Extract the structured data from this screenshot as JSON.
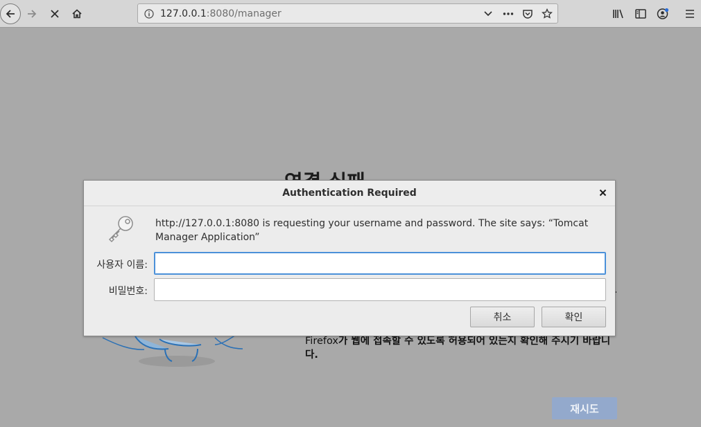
{
  "browser": {
    "url_host": "127.0.0.1",
    "url_path": ":8080/manager"
  },
  "error_page": {
    "title": "연결 실패",
    "description_brand": "Firefox",
    "description_rest": "가 웹에 접속할 수 있도록 허용되어 있는지 확인해 주시기 바랍니",
    "description_tail": "다.",
    "retry_label": "재시도"
  },
  "dialog": {
    "title": "Authentication Required",
    "message": "http://127.0.0.1:8080 is requesting your username and password. The site says: “Tomcat Manager Application”",
    "username_label": "사용자 이름:",
    "username_value": "",
    "password_label": "비밀번호:",
    "password_value": "",
    "cancel_label": "취소",
    "ok_label": "확인"
  },
  "colors": {
    "dim_overlay": "#a9a9a9",
    "focus_ring": "#4a90d9",
    "retry_button": "#93a9cc"
  }
}
